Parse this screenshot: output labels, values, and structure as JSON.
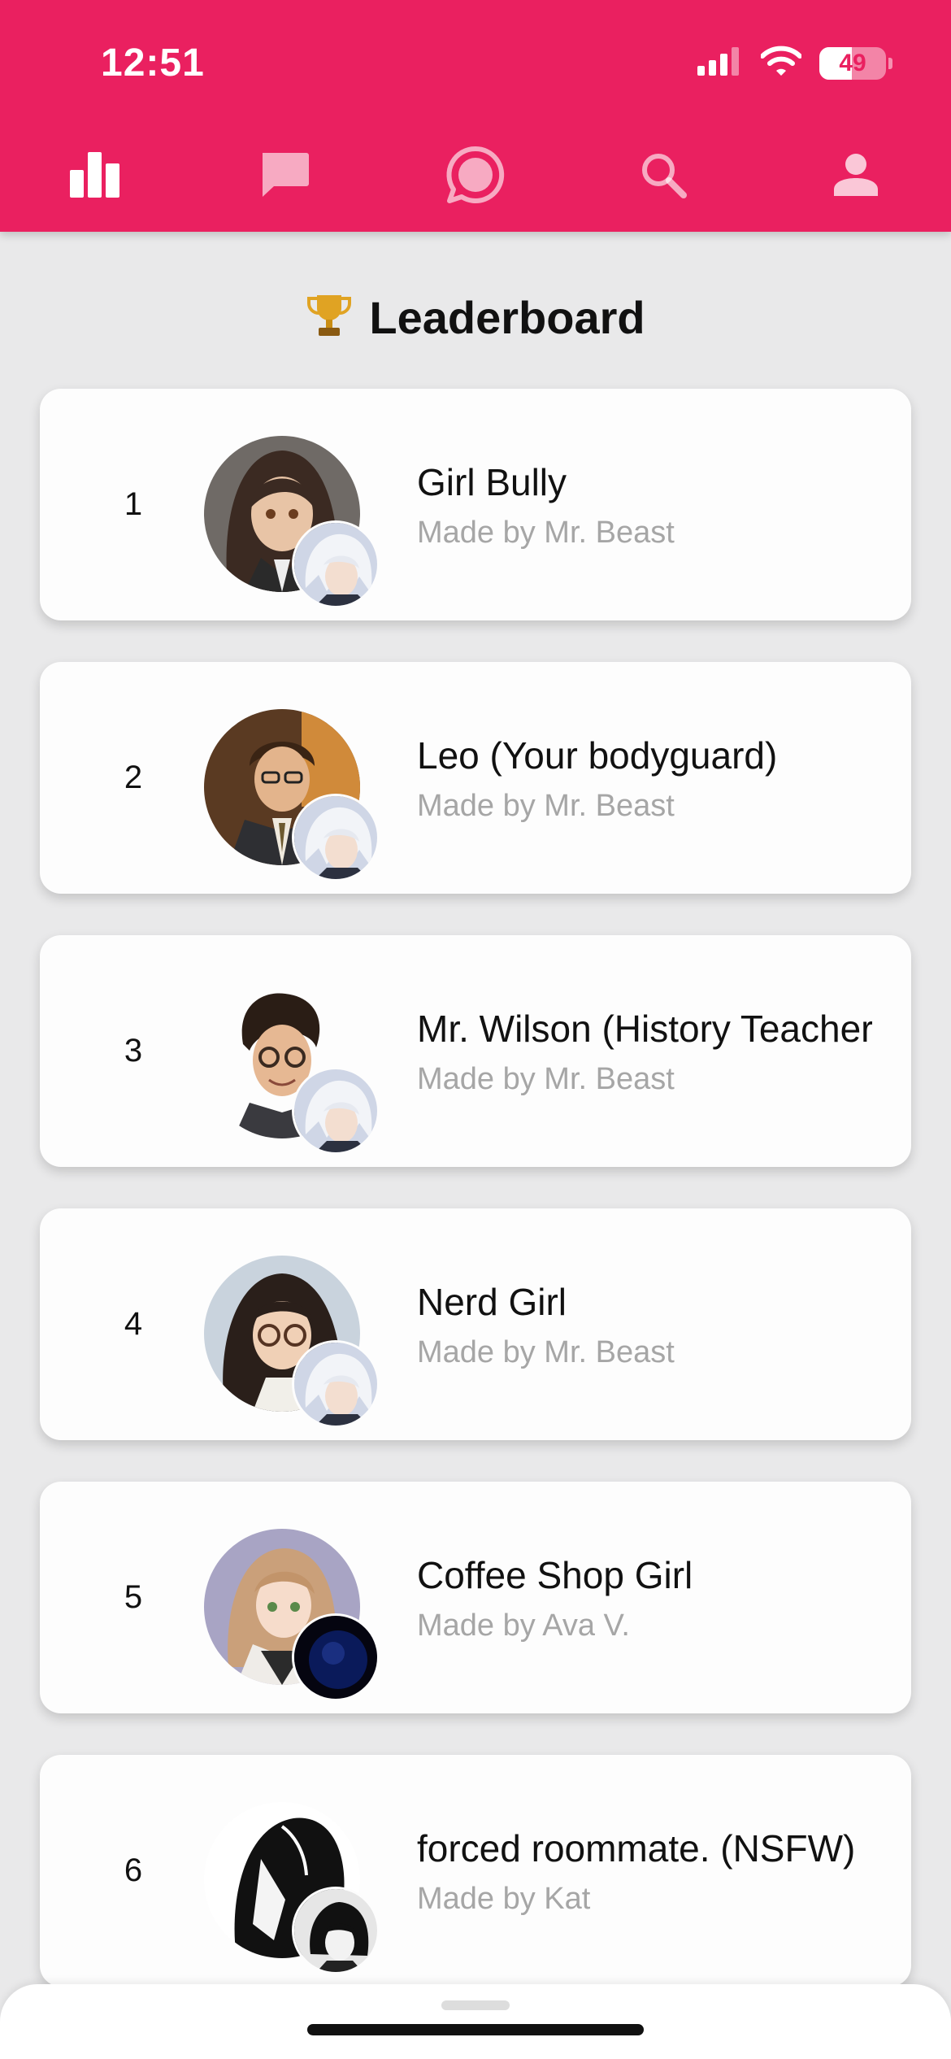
{
  "status_bar": {
    "time": "12:51",
    "battery_text": "49",
    "battery_level": 0.49,
    "icons": [
      "cellular-signal-icon",
      "wifi-icon",
      "battery-icon"
    ]
  },
  "colors": {
    "header": "#ea2060",
    "background": "#e9e9ea",
    "card": "#fdfdfd",
    "author_text": "#a6a6a6",
    "title_text": "#111111"
  },
  "nav": {
    "items": [
      {
        "icon": "leaderboard-bar-chart-icon",
        "active": true
      },
      {
        "icon": "chat-bubble-icon",
        "active": false
      },
      {
        "icon": "message-circle-icon",
        "active": false
      },
      {
        "icon": "search-icon",
        "active": false
      },
      {
        "icon": "profile-person-icon",
        "active": false
      }
    ]
  },
  "page": {
    "title": "Leaderboard",
    "title_icon": "trophy-icon"
  },
  "leaderboard": {
    "items": [
      {
        "rank": "1",
        "name": "Girl Bully",
        "author": "Made by Mr. Beast"
      },
      {
        "rank": "2",
        "name": "Leo (Your bodyguard)",
        "author": "Made by Mr. Beast"
      },
      {
        "rank": "3",
        "name": "Mr. Wilson (History Teacher)",
        "author": "Made by Mr. Beast"
      },
      {
        "rank": "4",
        "name": "Nerd Girl",
        "author": "Made by Mr. Beast"
      },
      {
        "rank": "5",
        "name": "Coffee Shop Girl",
        "author": "Made by Ava V."
      },
      {
        "rank": "6",
        "name": "forced roommate. (NSFW)",
        "author": "Made by Kat"
      }
    ]
  }
}
